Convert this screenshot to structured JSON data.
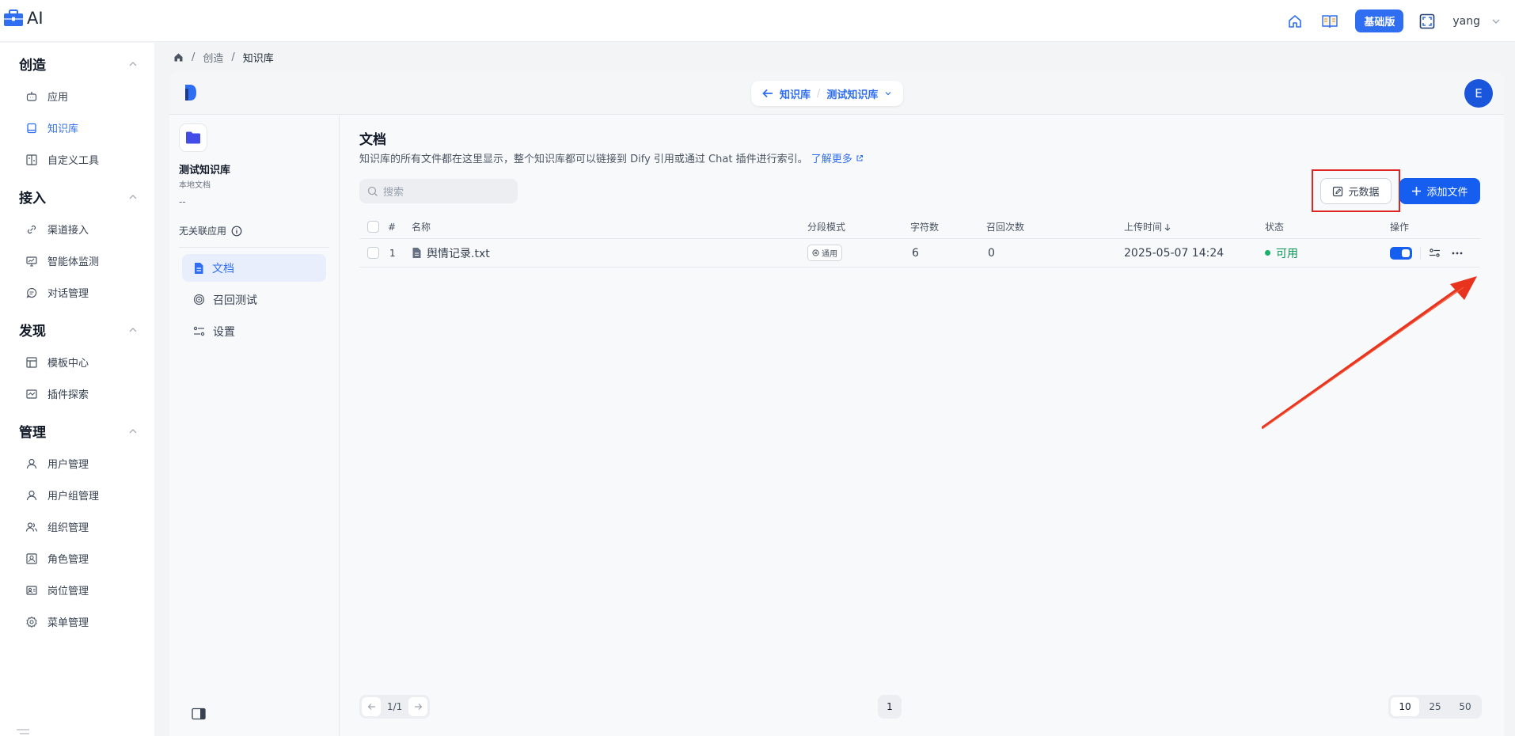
{
  "app": {
    "title": "AI"
  },
  "topbar": {
    "plan_badge": "基础版",
    "username": "yang"
  },
  "sidebar": {
    "sections": [
      {
        "title": "创造",
        "items": [
          {
            "label": "应用"
          },
          {
            "label": "知识库"
          },
          {
            "label": "自定义工具"
          }
        ]
      },
      {
        "title": "接入",
        "items": [
          {
            "label": "渠道接入"
          },
          {
            "label": "智能体监测"
          },
          {
            "label": "对话管理"
          }
        ]
      },
      {
        "title": "发现",
        "items": [
          {
            "label": "模板中心"
          },
          {
            "label": "插件探索"
          }
        ]
      },
      {
        "title": "管理",
        "items": [
          {
            "label": "用户管理"
          },
          {
            "label": "用户组管理"
          },
          {
            "label": "组织管理"
          },
          {
            "label": "角色管理"
          },
          {
            "label": "岗位管理"
          },
          {
            "label": "菜单管理"
          }
        ]
      }
    ]
  },
  "breadcrumb": {
    "items": [
      "创造",
      "知识库"
    ]
  },
  "header": {
    "back_label": "知识库",
    "dataset_label": "测试知识库",
    "avatar_letter": "E"
  },
  "dataset": {
    "name": "测试知识库",
    "type": "本地文档",
    "description": "--",
    "unlinked_label": "无关联应用",
    "nav": [
      {
        "label": "文档"
      },
      {
        "label": "召回测试"
      },
      {
        "label": "设置"
      }
    ]
  },
  "documents": {
    "title": "文档",
    "description": "知识库的所有文件都在这里显示，整个知识库都可以链接到 Dify 引用或通过 Chat 插件进行索引。",
    "learn_more": "了解更多",
    "search_placeholder": "搜索",
    "metadata_button": "元数据",
    "add_button": "添加文件",
    "columns": {
      "index": "#",
      "name": "名称",
      "mode": "分段模式",
      "chars": "字符数",
      "recalls": "召回次数",
      "upload_time": "上传时间",
      "status": "状态",
      "actions": "操作"
    },
    "rows": [
      {
        "index": "1",
        "name": "舆情记录.txt",
        "mode": "通用",
        "chars": "6",
        "recalls": "0",
        "upload_time": "2025-05-07 14:24",
        "status": "可用",
        "enabled": true
      }
    ]
  },
  "pagination": {
    "current": "1/1",
    "page": "1",
    "sizes": [
      "10",
      "25",
      "50"
    ],
    "selected_size": "10"
  },
  "colors": {
    "accent": "#155eef",
    "annotation": "#e02424",
    "status_ok": "#17b26a"
  }
}
